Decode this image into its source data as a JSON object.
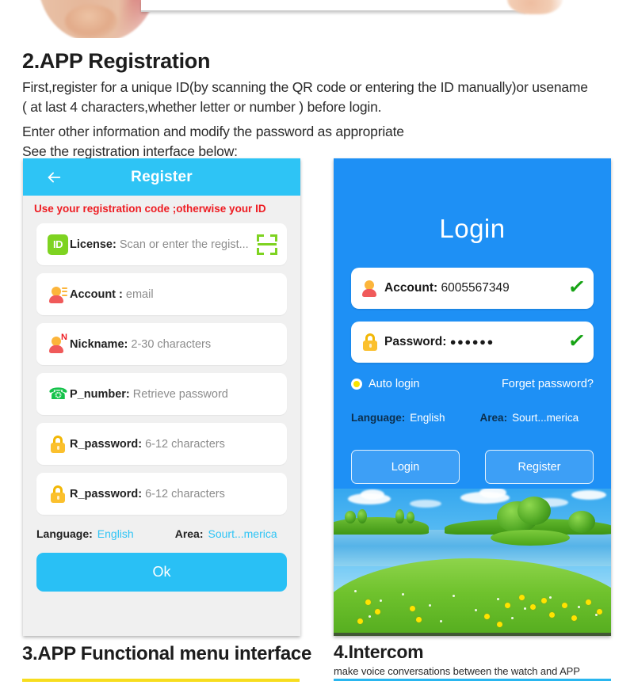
{
  "document": {
    "section_heading": "2.APP Registration",
    "paragraph_lines": [
      "First,register for a unique ID(by scanning the QR code or entering the ID manually)or usename",
      "( at last 4 characters,whether letter or number ) before login.",
      "Enter other information and modify the password as appropriate",
      "See the registration interface below:"
    ],
    "next_sections": {
      "left_heading": "3.APP Functional menu interface",
      "right_heading": "4.Intercom",
      "right_subtitle": "make voice conversations between the watch and APP"
    }
  },
  "register_screen": {
    "back_icon": "back-arrow-icon",
    "title": "Register",
    "notice": "Use your registration code ;otherwise your ID",
    "fields": [
      {
        "icon": "id-badge-icon",
        "icon_label": "ID",
        "label": "License:",
        "value": "Scan or enter the regist...",
        "tail_icon": "scan-qr-icon"
      },
      {
        "icon": "contact-person-icon",
        "icon_label": "",
        "label": "Account :",
        "value": "email",
        "tail_icon": ""
      },
      {
        "icon": "person-nickname-icon",
        "icon_label": "N",
        "label": "Nickname:",
        "value": "2-30 characters",
        "tail_icon": ""
      },
      {
        "icon": "phone-icon",
        "icon_label": "",
        "label": "P_number:",
        "value": "Retrieve password",
        "tail_icon": ""
      },
      {
        "icon": "lock-icon",
        "icon_label": "",
        "label": "R_password:",
        "value": "6-12 characters",
        "tail_icon": ""
      },
      {
        "icon": "lock-icon",
        "icon_label": "",
        "label": "R_password:",
        "value": "6-12 characters",
        "tail_icon": ""
      }
    ],
    "meta": {
      "language_label": "Language:",
      "language_value": "English",
      "area_label": "Area:",
      "area_value": "Sourt...merica"
    },
    "submit_label": "Ok"
  },
  "login_screen": {
    "title": "Login",
    "account": {
      "icon": "person-icon",
      "label": "Account:",
      "value": "6005567349",
      "status_icon": "green-check-icon"
    },
    "password": {
      "icon": "lock-icon",
      "label": "Password:",
      "value": "●●●●●●",
      "status_icon": "green-check-icon"
    },
    "auto_login_label": "Auto login",
    "forget_password_label": "Forget password?",
    "meta": {
      "language_label": "Language:",
      "language_value": "English",
      "area_label": "Area:",
      "area_value": "Sourt...merica"
    },
    "buttons": {
      "login": "Login",
      "register": "Register"
    }
  },
  "colors": {
    "header_blue": "#2ec4f5",
    "login_blue": "#1e90f5",
    "notice_red": "#ee1c22",
    "accent_green": "#7ed321",
    "check_green": "#17a315",
    "bar_yellow": "#f7dd1e",
    "bar_blue": "#29b6ef"
  }
}
